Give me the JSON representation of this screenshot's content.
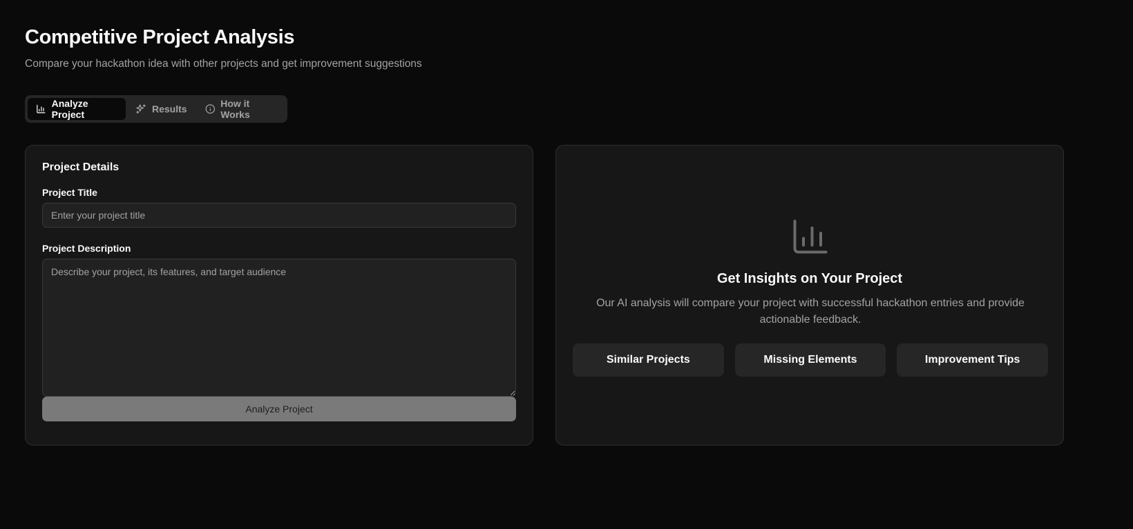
{
  "header": {
    "title": "Competitive Project Analysis",
    "subtitle": "Compare your hackathon idea with other projects and get improvement suggestions"
  },
  "tabs": [
    {
      "label": "Analyze Project",
      "icon": "bar-chart-icon",
      "active": true
    },
    {
      "label": "Results",
      "icon": "sparkles-icon",
      "active": false
    },
    {
      "label": "How it Works",
      "icon": "info-icon",
      "active": false
    }
  ],
  "form": {
    "card_title": "Project Details",
    "title_label": "Project Title",
    "title_placeholder": "Enter your project title",
    "title_value": "",
    "description_label": "Project Description",
    "description_placeholder": "Describe your project, its features, and target audience",
    "description_value": "",
    "submit_label": "Analyze Project"
  },
  "insights": {
    "icon": "bar-chart-icon",
    "title": "Get Insights on Your Project",
    "description": "Our AI analysis will compare your project with successful hackathon entries and provide actionable feedback.",
    "features": [
      "Similar Projects",
      "Missing Elements",
      "Improvement Tips"
    ]
  },
  "colors": {
    "background": "#0a0a0a",
    "card": "#171717",
    "muted_text": "#a3a3a3",
    "button_disabled": "#7a7a7a"
  }
}
